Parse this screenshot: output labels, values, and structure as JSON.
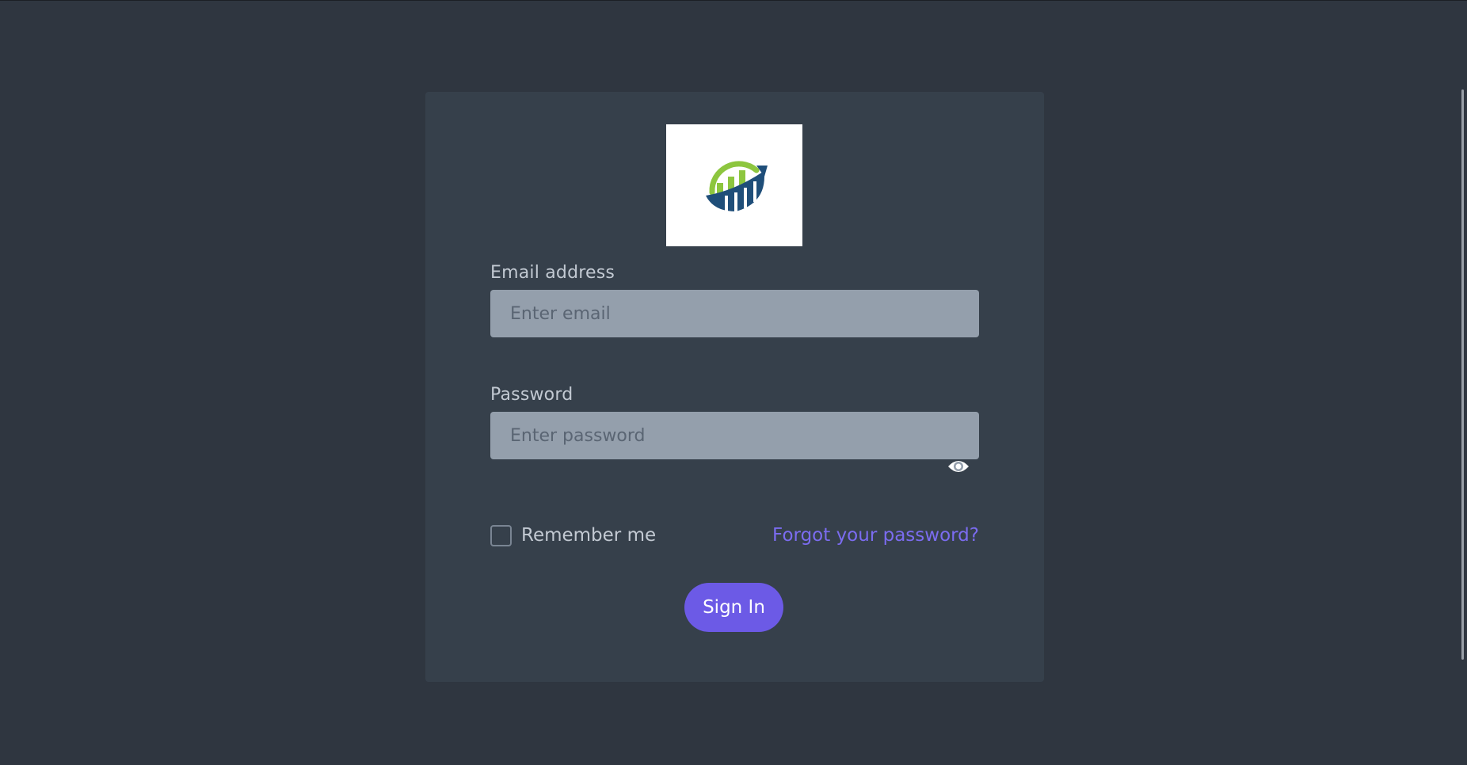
{
  "login": {
    "email_label": "Email address",
    "email_placeholder": "Enter email",
    "email_value": "",
    "password_label": "Password",
    "password_placeholder": "Enter password",
    "password_value": "",
    "remember_label": "Remember me",
    "remember_checked": false,
    "forgot_label": "Forgot your password?",
    "signin_label": "Sign In"
  },
  "icons": {
    "logo": "growth-chart-logo-icon",
    "password_toggle": "eye-icon"
  },
  "colors": {
    "background": "#2f3640",
    "card": "#36404b",
    "input": "#949fac",
    "accent": "#6c5ae6",
    "link": "#7b6cf0",
    "logo_green": "#8dc63f",
    "logo_blue": "#1f4e79"
  }
}
